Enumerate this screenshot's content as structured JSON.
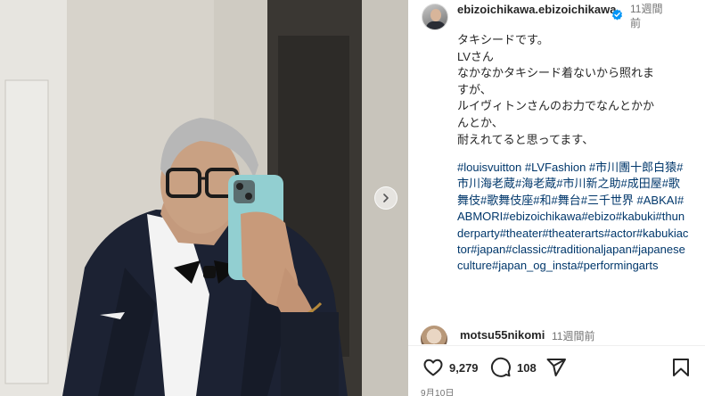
{
  "post": {
    "username": "ebizoichikawa.ebizoichikawa",
    "time_ago": "11週間前",
    "caption_lines": [
      "タキシードです。",
      "LVさん",
      "なかなかタキシード着ないから照れま\nすが、",
      "ルイヴィトンさんのお力でなんとかか\nんとか、",
      "耐えれてると思ってます、"
    ],
    "hashtags": "#louisvuitton #LVFashion #市川團十郎白猿#市川海老蔵#海老蔵#市川新之助#成田屋#歌舞伎#歌舞伎座#和#舞台#三千世界 #ABKAI#ABMORI#ebizoichikawa#ebizo#kabuki#thunderparty#theater#theaterarts#actor#kabukiactor#japan#classic#traditionaljapan#japaneseculture#japan_og_insta#performingarts"
  },
  "comment": {
    "username": "motsu55nikomi",
    "time_ago": "11週間前"
  },
  "stats": {
    "likes": "9,279",
    "comments": "108"
  },
  "date": "9月10日",
  "icons": {
    "like": "heart-icon",
    "comment": "comment-bubble-icon",
    "share": "paper-plane-icon",
    "save": "bookmark-icon",
    "verified": "verified-badge-icon",
    "next": "chevron-right-icon"
  },
  "colors": {
    "hashtag": "#00376b",
    "verified": "#0095f6",
    "muted": "#737373"
  }
}
